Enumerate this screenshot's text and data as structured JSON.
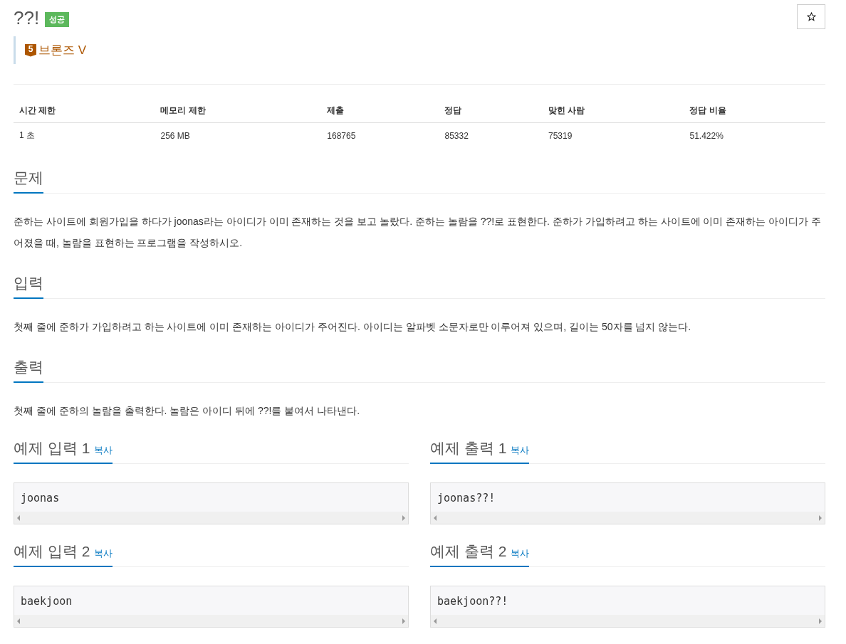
{
  "title": "??!",
  "result_badge": "성공",
  "starred": false,
  "tier": {
    "number": "5",
    "label": "브론즈 V"
  },
  "info_table": {
    "columns": [
      "시간 제한",
      "메모리 제한",
      "제출",
      "정답",
      "맞힌 사람",
      "정답 비율"
    ],
    "rows": [
      [
        "1 초",
        "256 MB",
        "168765",
        "85332",
        "75319",
        "51.422%"
      ]
    ]
  },
  "sections": [
    {
      "heading": "문제",
      "text": "준하는 사이트에 회원가입을 하다가 joonas라는 아이디가 이미 존재하는 것을 보고 놀랐다. 준하는 놀람을 ??!로 표현한다. 준하가 가입하려고 하는 사이트에 이미 존재하는 아이디가 주어졌을 때, 놀람을 표현하는 프로그램을 작성하시오."
    },
    {
      "heading": "입력",
      "text": "첫째 줄에 준하가 가입하려고 하는 사이트에 이미 존재하는 아이디가 주어진다. 아이디는 알파벳 소문자로만 이루어져 있으며, 길이는 50자를 넘지 않는다."
    },
    {
      "heading": "출력",
      "text": "첫째 줄에 준하의 놀람을 출력한다. 놀람은 아이디 뒤에 ??!를 붙여서 나타낸다."
    }
  ],
  "samples": [
    {
      "input_heading": "예제 입력 1",
      "input_copy": "복사",
      "input": "joonas",
      "output_heading": "예제 출력 1",
      "output_copy": "복사",
      "output": "joonas??!"
    },
    {
      "input_heading": "예제 입력 2",
      "input_copy": "복사",
      "input": "baekjoon",
      "output_heading": "예제 출력 2",
      "output_copy": "복사",
      "output": "baekjoon??!"
    }
  ]
}
